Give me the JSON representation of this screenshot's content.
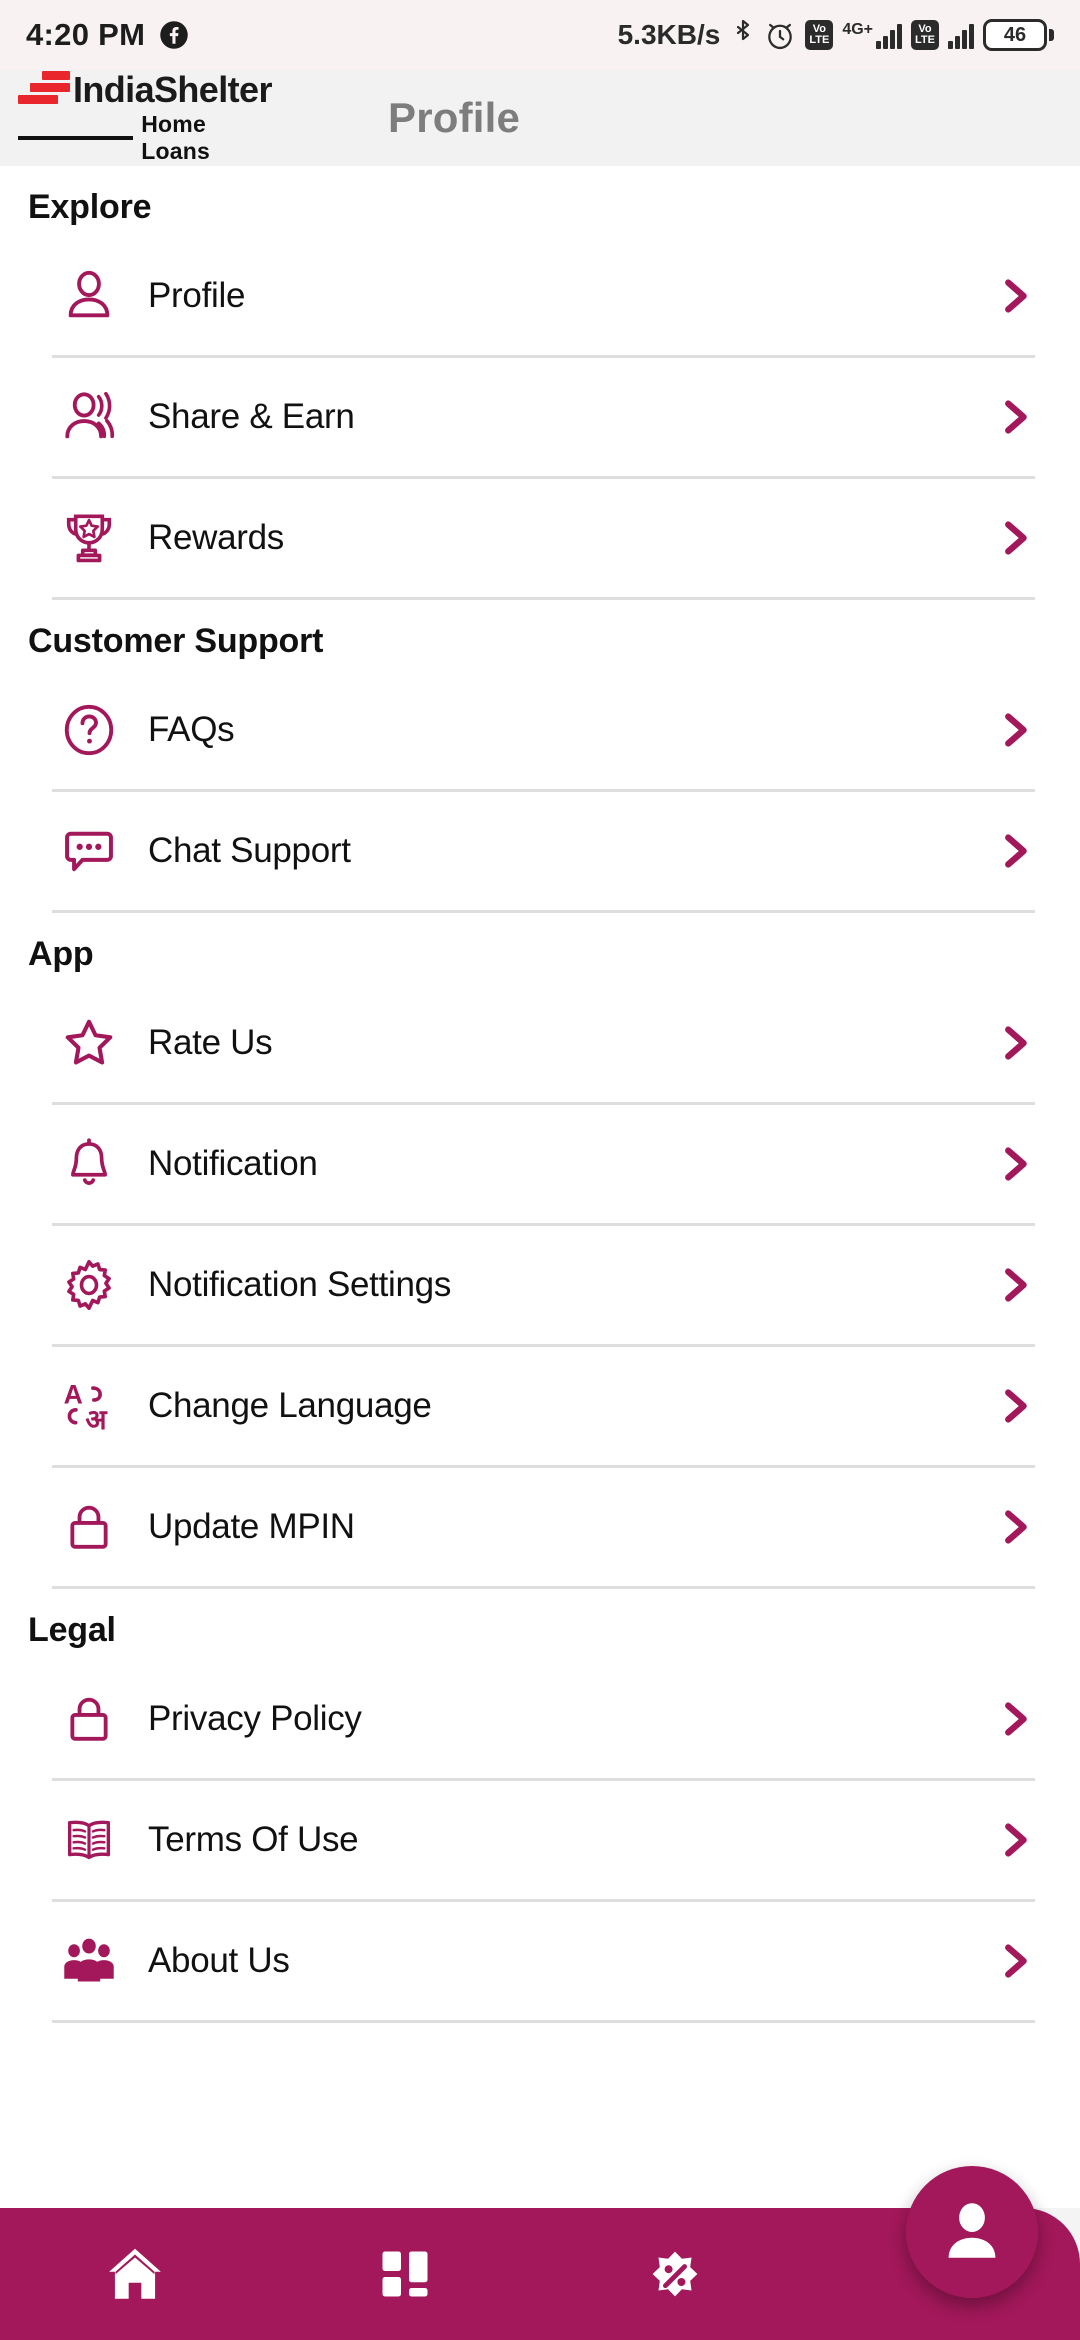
{
  "status_bar": {
    "time": "4:20 PM",
    "left_icons": [
      "facebook-icon"
    ],
    "network_speed": "5.3KB/s",
    "icons": [
      "bluetooth-icon",
      "alarm-icon",
      "volte-icon",
      "signal-icon",
      "volte-icon",
      "signal-icon"
    ],
    "network_generation": "4G+",
    "volte_top": "Vo",
    "volte_bottom": "LTE",
    "battery_level": "46"
  },
  "app_bar": {
    "brand_name": "IndiaShelter",
    "brand_tagline": "Home Loans",
    "title": "Profile"
  },
  "sections": [
    {
      "title": "Explore",
      "items": [
        {
          "label": "Profile",
          "icon": "person-outline-icon"
        },
        {
          "label": "Share & Earn",
          "icon": "share-person-icon"
        },
        {
          "label": "Rewards",
          "icon": "trophy-icon"
        }
      ]
    },
    {
      "title": "Customer Support",
      "items": [
        {
          "label": "FAQs",
          "icon": "question-circle-icon"
        },
        {
          "label": "Chat Support",
          "icon": "chat-bubble-icon"
        }
      ]
    },
    {
      "title": "App",
      "items": [
        {
          "label": "Rate Us",
          "icon": "star-outline-icon"
        },
        {
          "label": "Notification",
          "icon": "bell-icon"
        },
        {
          "label": "Notification Settings",
          "icon": "gear-icon"
        },
        {
          "label": "Change Language",
          "icon": "language-icon"
        },
        {
          "label": "Update MPIN",
          "icon": "lock-icon"
        }
      ]
    },
    {
      "title": "Legal",
      "items": [
        {
          "label": "Privacy Policy",
          "icon": "lock-icon"
        },
        {
          "label": "Terms Of Use",
          "icon": "open-book-icon"
        },
        {
          "label": "About Us",
          "icon": "people-group-icon"
        }
      ]
    }
  ],
  "bottom_nav": {
    "items": [
      {
        "icon": "home-icon",
        "name": "home"
      },
      {
        "icon": "grid-dashboard-icon",
        "name": "dashboard"
      },
      {
        "icon": "percent-offer-icon",
        "name": "offers"
      }
    ],
    "fab": {
      "icon": "person-filled-icon",
      "name": "profile"
    }
  },
  "colors": {
    "brand_maroon": "#a3185a",
    "brand_red": "#e8262b",
    "status_bar_bg": "#f8f2f2",
    "app_bar_bg": "#f2f2f2",
    "title_gray": "#7d7d7d",
    "divider": "#dedede"
  }
}
